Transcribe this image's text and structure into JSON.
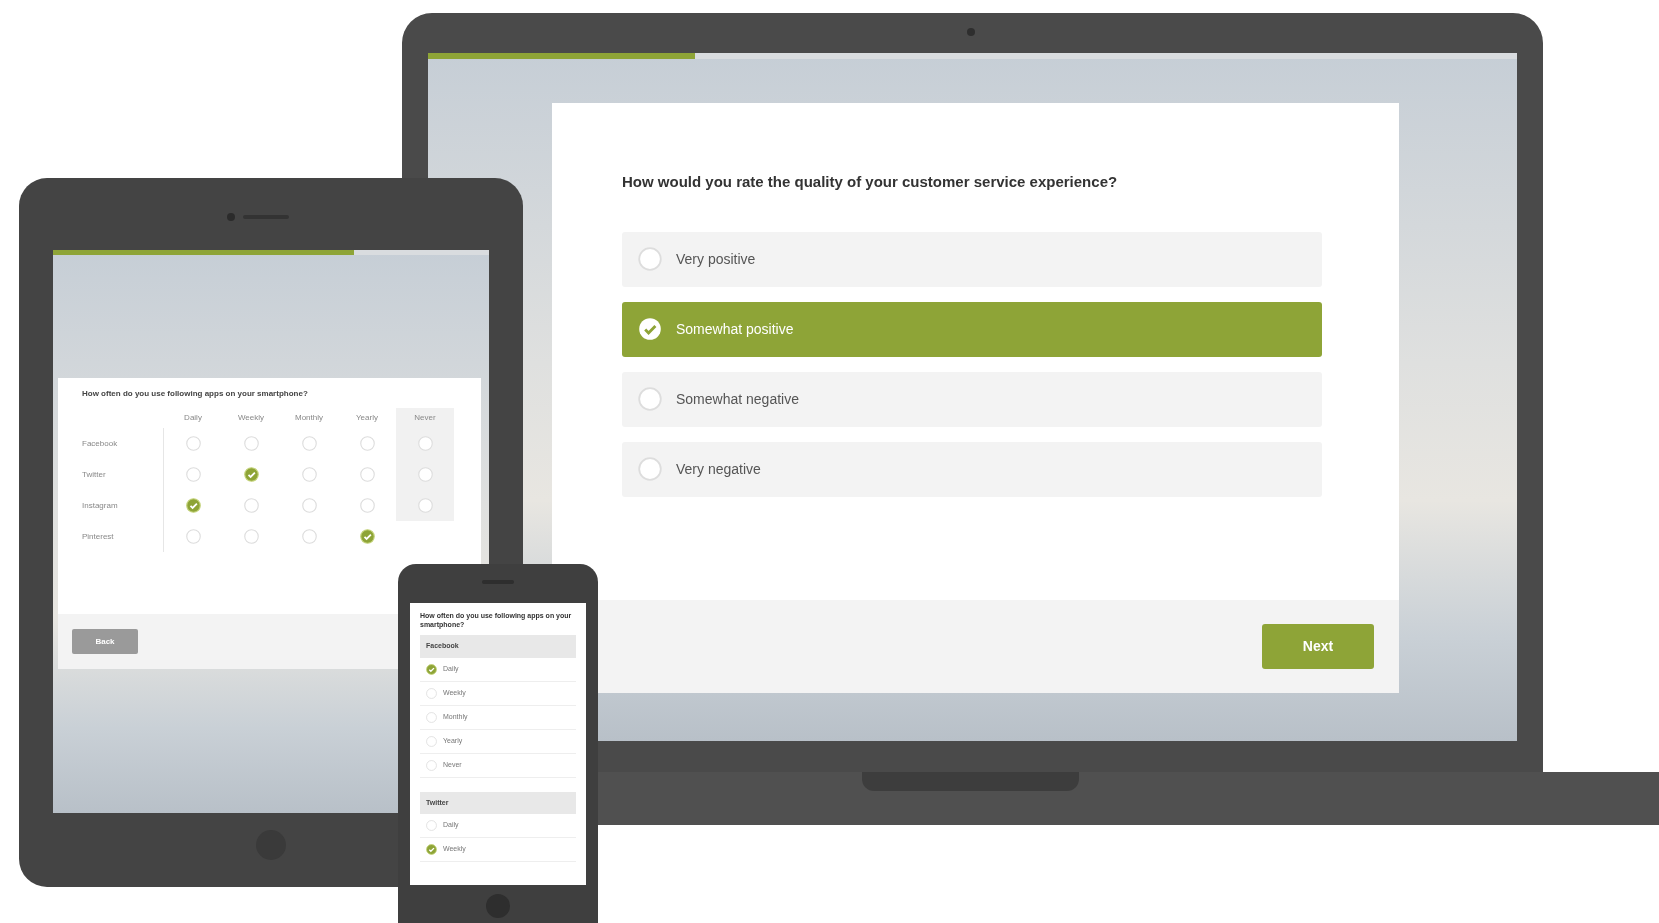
{
  "laptop": {
    "progress": {
      "level": 0.245
    },
    "question": "How would you rate the quality of your customer service experience?",
    "options": [
      {
        "label": "Very positive",
        "selected": false
      },
      {
        "label": "Somewhat positive",
        "selected": true
      },
      {
        "label": "Somewhat negative",
        "selected": false
      },
      {
        "label": "Very negative",
        "selected": false
      }
    ],
    "next_button": "Next"
  },
  "tablet": {
    "progress": {
      "level": 0.69
    },
    "question": "How often do you use following apps on your smartphone?",
    "columns": [
      {
        "label": "Daily",
        "highlighted": false
      },
      {
        "label": "Weekly",
        "highlighted": false
      },
      {
        "label": "Monthly",
        "highlighted": false
      },
      {
        "label": "Yearly",
        "highlighted": false
      },
      {
        "label": "Never",
        "highlighted": true
      }
    ],
    "rows": [
      {
        "label": "Facebook",
        "answers": [
          {
            "selected": false
          },
          {
            "selected": false
          },
          {
            "selected": false
          },
          {
            "selected": false
          },
          {
            "selected": false
          }
        ]
      },
      {
        "label": "Twitter",
        "answers": [
          {
            "selected": false
          },
          {
            "selected": true
          },
          {
            "selected": false
          },
          {
            "selected": false
          },
          {
            "selected": false
          }
        ]
      },
      {
        "label": "Instagram",
        "answers": [
          {
            "selected": true
          },
          {
            "selected": false
          },
          {
            "selected": false
          },
          {
            "selected": false
          },
          {
            "selected": false
          }
        ]
      },
      {
        "label": "Pinterest",
        "answers": [
          {
            "selected": false
          },
          {
            "selected": false
          },
          {
            "selected": false
          },
          {
            "selected": true
          }
        ]
      }
    ],
    "back_button": "Back"
  },
  "phone": {
    "question": "How often do you use following apps on your smartphone?",
    "groups": [
      {
        "label": "Facebook",
        "options": [
          {
            "label": "Daily",
            "selected": true
          },
          {
            "label": "Weekly",
            "selected": false
          },
          {
            "label": "Monthly",
            "selected": false
          },
          {
            "label": "Yearly",
            "selected": false
          },
          {
            "label": "Never",
            "selected": false
          }
        ]
      },
      {
        "label": "Twitter",
        "options": [
          {
            "label": "Daily",
            "selected": false
          },
          {
            "label": "Weekly",
            "selected": true
          }
        ]
      }
    ]
  }
}
